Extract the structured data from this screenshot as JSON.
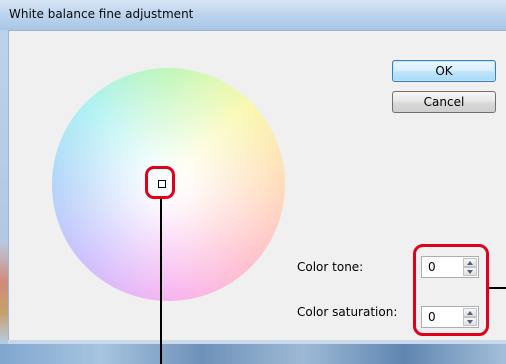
{
  "window": {
    "title": "White balance fine adjustment"
  },
  "buttons": {
    "ok_label": "OK",
    "cancel_label": "Cancel"
  },
  "color_tone": {
    "label": "Color tone:",
    "value": "0"
  },
  "color_saturation": {
    "label": "Color saturation:",
    "value": "0"
  },
  "colors": {
    "highlight": "#e0001a",
    "titlebar": "#bad2ec",
    "dialog_bg": "#f0f0f0"
  },
  "icons": {
    "spin_up": "up-arrow-icon",
    "spin_down": "down-arrow-icon"
  }
}
